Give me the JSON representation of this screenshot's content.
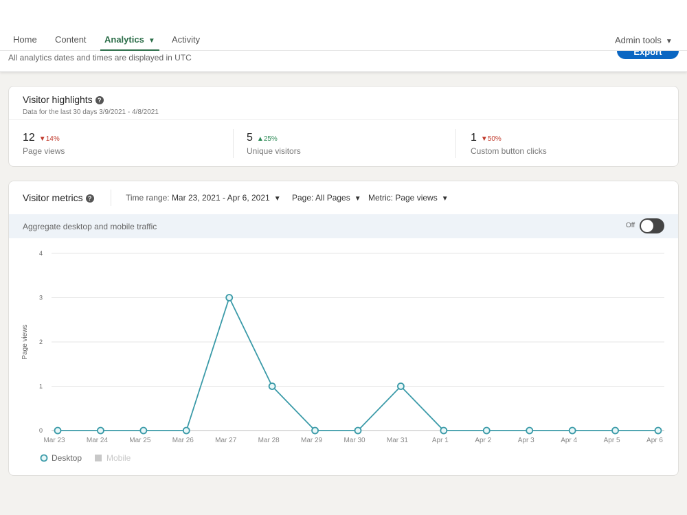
{
  "nav": {
    "tabs": [
      {
        "label": "Home"
      },
      {
        "label": "Content"
      },
      {
        "label": "Analytics",
        "active": true
      },
      {
        "label": "Activity"
      }
    ],
    "admin": "Admin tools",
    "utc_note": "All analytics dates and times are displayed in UTC",
    "export": "Export"
  },
  "highlights": {
    "title": "Visitor highlights",
    "subtitle": "Data for the last 30 days 3/9/2021 - 4/8/2021",
    "stats": [
      {
        "value": "12",
        "change": "14%",
        "direction": "down",
        "label": "Page views"
      },
      {
        "value": "5",
        "change": "25%",
        "direction": "up",
        "label": "Unique visitors"
      },
      {
        "value": "1",
        "change": "50%",
        "direction": "down",
        "label": "Custom button clicks"
      }
    ]
  },
  "metrics": {
    "title": "Visitor metrics",
    "time_range_label": "Time range:",
    "time_range": "Mar 23, 2021 - Apr 6, 2021",
    "page": "Page: All Pages",
    "metric": "Metric: Page views",
    "aggregate": "Aggregate desktop and mobile traffic",
    "toggle_state": "Off"
  },
  "chart_data": {
    "type": "line",
    "ylabel": "Page views",
    "ylim": [
      0,
      4
    ],
    "yticks": [
      "0",
      "1",
      "2",
      "3",
      "4"
    ],
    "grid": true,
    "legend_placement": "bottom-left",
    "x": [
      "Mar 23",
      "Mar 24",
      "Mar 25",
      "Mar 26",
      "Mar 27",
      "Mar 28",
      "Mar 29",
      "Mar 30",
      "Mar 31",
      "Apr 1",
      "Apr 2",
      "Apr 3",
      "Apr 4",
      "Apr 5",
      "Apr 6"
    ],
    "series": [
      {
        "name": "Desktop",
        "values": [
          0,
          0,
          0,
          0,
          3,
          1,
          0,
          0,
          1,
          0,
          0,
          0,
          0,
          0,
          0
        ],
        "color": "#3a9aa8",
        "enabled": true
      },
      {
        "name": "Mobile",
        "values": [],
        "color": "#c8c8c8",
        "enabled": false
      }
    ]
  }
}
